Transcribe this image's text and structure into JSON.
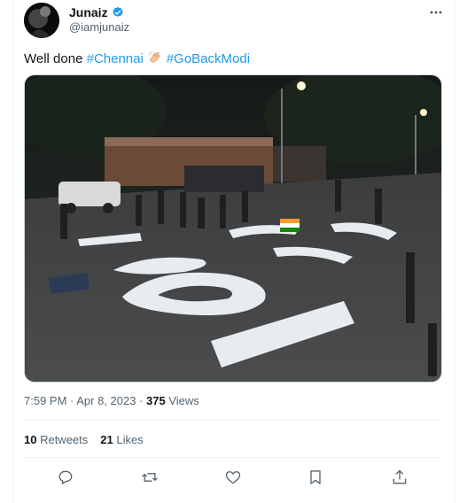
{
  "author": {
    "name": "Junaiz",
    "handle": "@iamjunaiz",
    "verified_icon": "verified-badge-icon",
    "avatar_icon": "avatar"
  },
  "tweet": {
    "text_start": "Well done ",
    "hashtag1": "#Chennai",
    "emoji_icon": "clapping-hands-icon",
    "hashtag2": "#GoBackModi"
  },
  "meta": {
    "time": "7:59 PM",
    "sep1": " · ",
    "date": "Apr 8, 2023",
    "sep2": " · ",
    "views_count": "375",
    "views_label": " Views"
  },
  "stats": {
    "retweets_count": "10",
    "retweets_label": " Retweets",
    "likes_count": "21",
    "likes_label": " Likes"
  },
  "actions": [
    "reply-icon",
    "retweet-icon",
    "like-icon",
    "bookmark-icon",
    "share-icon"
  ],
  "colors": {
    "link": "#1d9bf0",
    "secondary_text": "#536471",
    "primary_text": "#0f1419",
    "divider": "#eff3f4"
  }
}
